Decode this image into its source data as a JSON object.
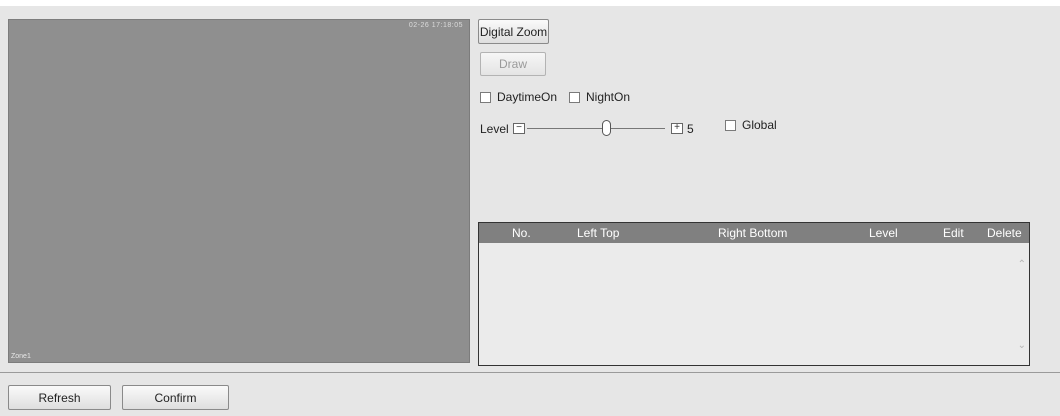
{
  "video": {
    "osd_time": "02-26 17:18:05",
    "osd_zone": "Zone1"
  },
  "controls": {
    "digital_zoom_label": "Digital Zoom",
    "draw_label": "Draw",
    "daytime_label": "DaytimeOn",
    "night_label": "NightOn",
    "level_label": "Level",
    "minus_symbol": "−",
    "plus_symbol": "+",
    "level_value": "5",
    "level_fraction": 0.5,
    "global_label": "Global"
  },
  "table": {
    "headers": [
      "No.",
      "Left Top",
      "Right Bottom",
      "Level",
      "Edit",
      "Delete"
    ],
    "rows": []
  },
  "footer": {
    "refresh_label": "Refresh",
    "confirm_label": "Confirm"
  }
}
